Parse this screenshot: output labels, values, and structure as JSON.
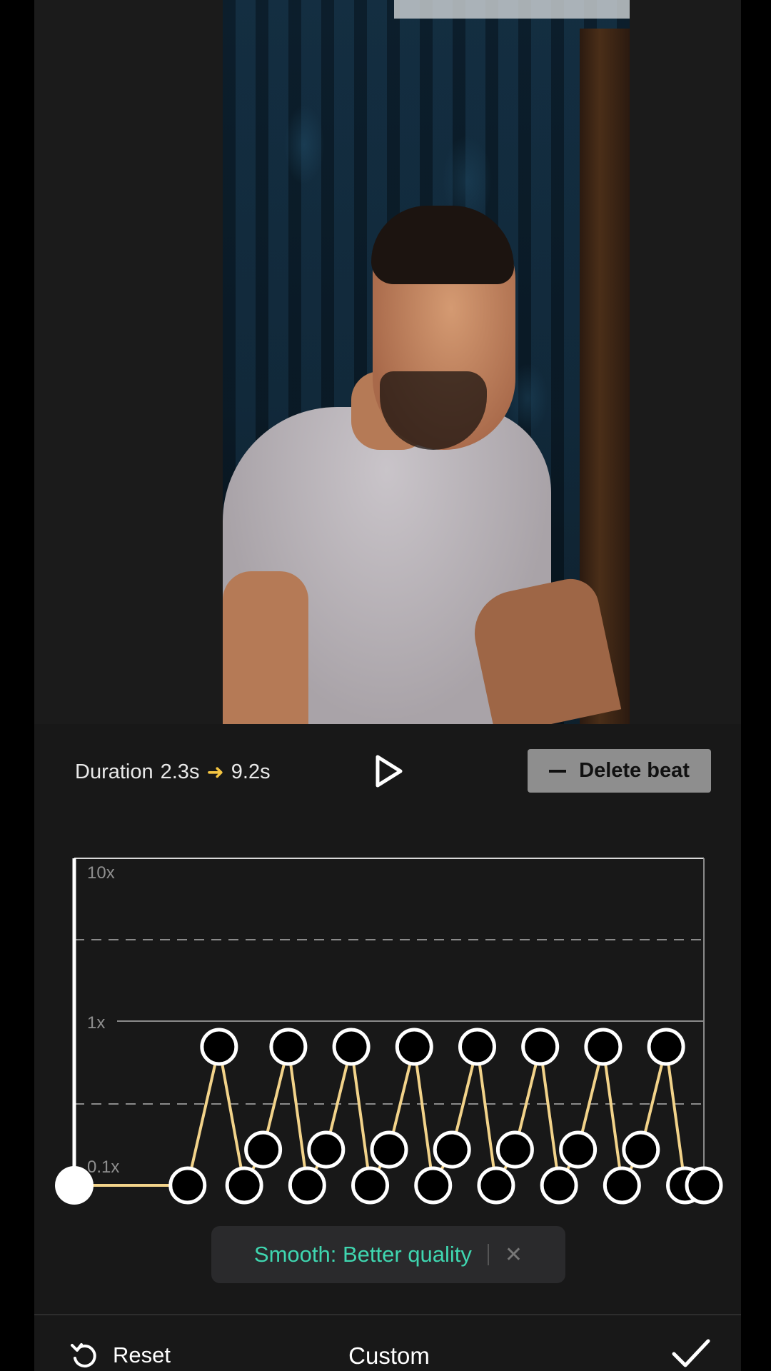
{
  "header": {
    "duration_label": "Duration",
    "duration_from": "2.3s",
    "duration_to": "9.2s",
    "delete_beat_label": "Delete beat"
  },
  "graph": {
    "y_labels": [
      "10x",
      "1x",
      "0.1x"
    ],
    "line_color": "#f2d38a",
    "beats": [
      {
        "t": 0.0,
        "speed": "0.1x"
      },
      {
        "t": 0.18,
        "speed": "0.1x"
      },
      {
        "t": 0.23,
        "speed": "1x"
      },
      {
        "t": 0.27,
        "speed": "0.1x"
      },
      {
        "t": 0.3,
        "speed": "0.2x"
      },
      {
        "t": 0.34,
        "speed": "1x"
      },
      {
        "t": 0.37,
        "speed": "0.1x"
      },
      {
        "t": 0.4,
        "speed": "0.2x"
      },
      {
        "t": 0.44,
        "speed": "1x"
      },
      {
        "t": 0.47,
        "speed": "0.1x"
      },
      {
        "t": 0.5,
        "speed": "0.2x"
      },
      {
        "t": 0.54,
        "speed": "1x"
      },
      {
        "t": 0.57,
        "speed": "0.1x"
      },
      {
        "t": 0.6,
        "speed": "0.2x"
      },
      {
        "t": 0.64,
        "speed": "1x"
      },
      {
        "t": 0.67,
        "speed": "0.1x"
      },
      {
        "t": 0.7,
        "speed": "0.2x"
      },
      {
        "t": 0.74,
        "speed": "1x"
      },
      {
        "t": 0.77,
        "speed": "0.1x"
      },
      {
        "t": 0.8,
        "speed": "0.2x"
      },
      {
        "t": 0.84,
        "speed": "1x"
      },
      {
        "t": 0.87,
        "speed": "0.1x"
      },
      {
        "t": 0.9,
        "speed": "0.2x"
      },
      {
        "t": 0.94,
        "speed": "1x"
      },
      {
        "t": 0.97,
        "speed": "0.1x"
      },
      {
        "t": 1.0,
        "speed": "0.1x"
      }
    ]
  },
  "smooth_chip": {
    "label": "Smooth: Better quality"
  },
  "footer": {
    "reset_label": "Reset",
    "mode_title": "Custom"
  }
}
